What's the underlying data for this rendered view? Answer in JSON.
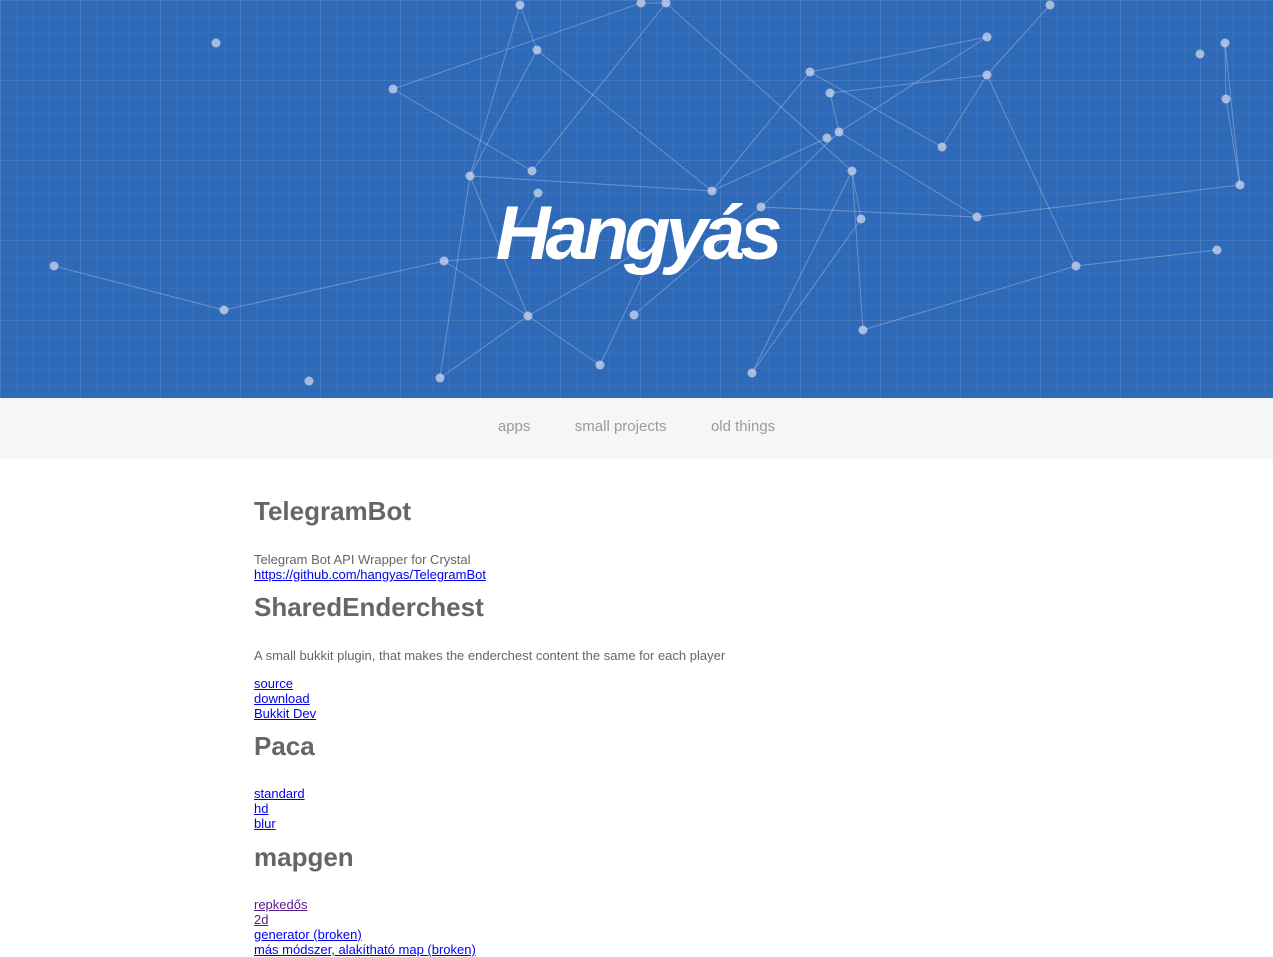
{
  "header": {
    "title": "Hangyás"
  },
  "nav": {
    "items": [
      {
        "label": "apps"
      },
      {
        "label": "small projects"
      },
      {
        "label": "old things"
      }
    ]
  },
  "sections": [
    {
      "title": "TelegramBot",
      "description": "Telegram Bot API Wrapper for Crystal",
      "links": [
        "https://github.com/hangyas/TelegramBot"
      ]
    },
    {
      "title": "SharedEnderchest",
      "description": "A small bukkit plugin, that makes the enderchest content the same for each player",
      "links": [
        "source",
        "download",
        "Bukkit Dev"
      ]
    },
    {
      "title": "Paca",
      "links": [
        "standard",
        "hd",
        "blur"
      ]
    },
    {
      "title": "mapgen",
      "links": [
        "repkedős",
        "2d",
        "generator (broken)",
        "más módszer, alakítható map (broken)"
      ]
    }
  ],
  "colors": {
    "hero_background": "#2f6ab8",
    "nav_background": "#f6f6f6",
    "heading": "#666666",
    "link": "#0000ee",
    "visited_link": "#551a8b"
  }
}
